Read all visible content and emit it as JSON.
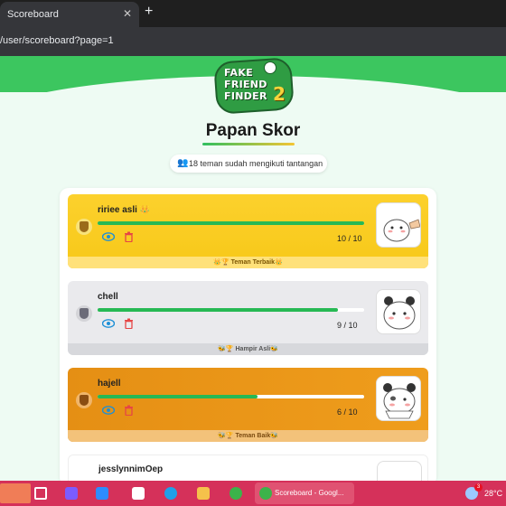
{
  "browser": {
    "tab_title": "Scoreboard",
    "tab_close": "✕",
    "new_tab": "+",
    "url": "/user/scoreboard?page=1"
  },
  "logo": {
    "line1": "FAKE",
    "line2": "FRIEND",
    "line3": "FINDER",
    "number": "2"
  },
  "page": {
    "title": "Papan Skor",
    "followers_text": "18 teman sudah mengikuti tantangan"
  },
  "entries": [
    {
      "name": "ririee asli",
      "crown": "👑",
      "score_text": "10 / 10",
      "score": 10,
      "max": 10,
      "footer": "👑🏆 Teman Terbaik👑",
      "rank": "gold"
    },
    {
      "name": "chell",
      "score_text": "9 / 10",
      "score": 9,
      "max": 10,
      "footer": "🐝🏆 Hampir Asli🐝",
      "rank": "silver"
    },
    {
      "name": "hajell",
      "score_text": "6 / 10",
      "score": 6,
      "max": 10,
      "footer": "🐝🏆 Teman Baik🐝",
      "rank": "bronze"
    },
    {
      "name": "jesslynnimOep",
      "rank": "plain"
    }
  ],
  "taskbar": {
    "active_window": "Scoreboard - Googl...",
    "temperature": "28°C",
    "notification_count": "3"
  },
  "colors": {
    "brand_green": "#3cc65f",
    "progress_green": "#27b954",
    "gold": "#fcd12d",
    "silver": "#eaeaed",
    "bronze": "#e58f14",
    "taskbar": "#d5315a"
  }
}
